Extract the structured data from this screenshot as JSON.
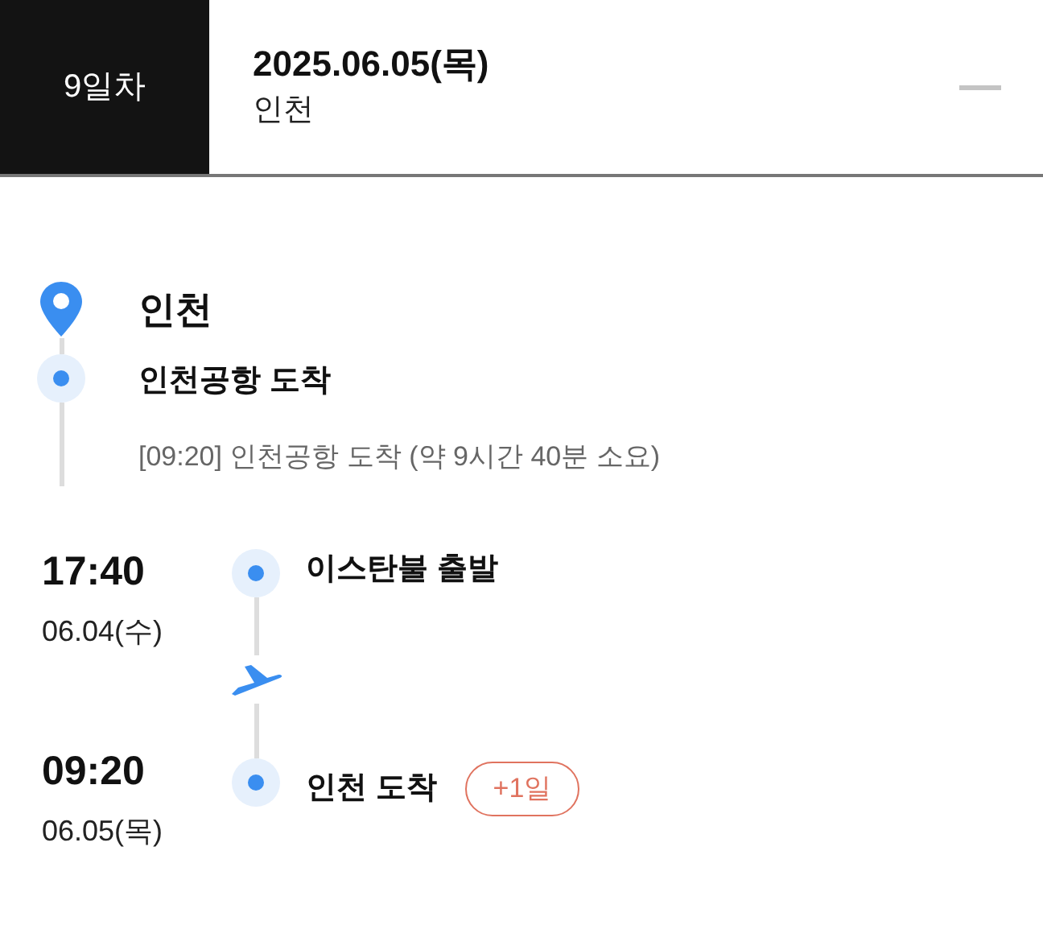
{
  "header": {
    "day_label": "9일차",
    "date": "2025.06.05(목)",
    "city": "인천",
    "expanded": true
  },
  "place": {
    "title": "인천",
    "stop": "인천공항 도착",
    "detail": "[09:20] 인천공항 도착 (약 9시간 40분 소요)"
  },
  "flight": {
    "departure": {
      "time": "17:40",
      "date": "06.04(수)",
      "label": "이스탄불 출발"
    },
    "arrival": {
      "time": "09:20",
      "date": "06.05(목)",
      "label": "인천 도착",
      "badge": "+1일"
    }
  }
}
